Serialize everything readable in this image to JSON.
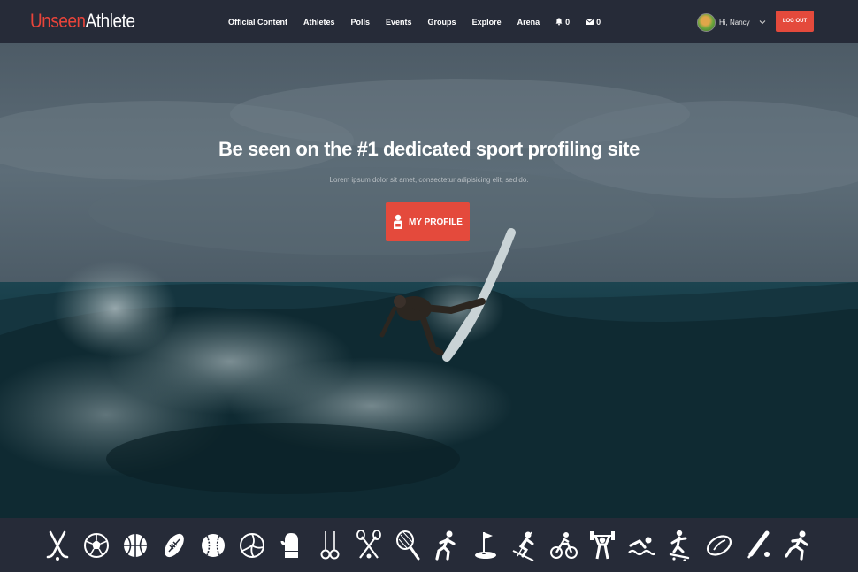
{
  "header": {
    "logo_part1": "Unseen",
    "logo_part2": "Athlete",
    "nav": [
      "Official Content",
      "Athletes",
      "Polls",
      "Events",
      "Groups",
      "Explore",
      "Arena"
    ],
    "notifications_count": "0",
    "messages_count": "0",
    "greeting": "Hi, Nancy",
    "logout_label": "LOG OUT"
  },
  "hero": {
    "title": "Be seen on the #1 dedicated sport profiling site",
    "subtitle": "Lorem ipsum dolor sit amet, consectetur adipisicing elit, sed do.",
    "button_label": "MY PROFILE"
  },
  "sports": [
    "hockey-icon",
    "soccer-ball-icon",
    "basketball-icon",
    "american-football-icon",
    "baseball-icon",
    "volleyball-icon",
    "boxing-glove-icon",
    "gymnastics-rings-icon",
    "lacrosse-icon",
    "tennis-racket-icon",
    "runner-icon",
    "golf-icon",
    "skiing-icon",
    "cycling-icon",
    "weightlifting-icon",
    "swimming-icon",
    "skateboarding-icon",
    "rugby-ball-icon",
    "cricket-icon",
    "sprinter-icon"
  ],
  "colors": {
    "accent": "#e44a3c",
    "header_bg": "#262b38",
    "logo_accent": "#e8443a"
  }
}
